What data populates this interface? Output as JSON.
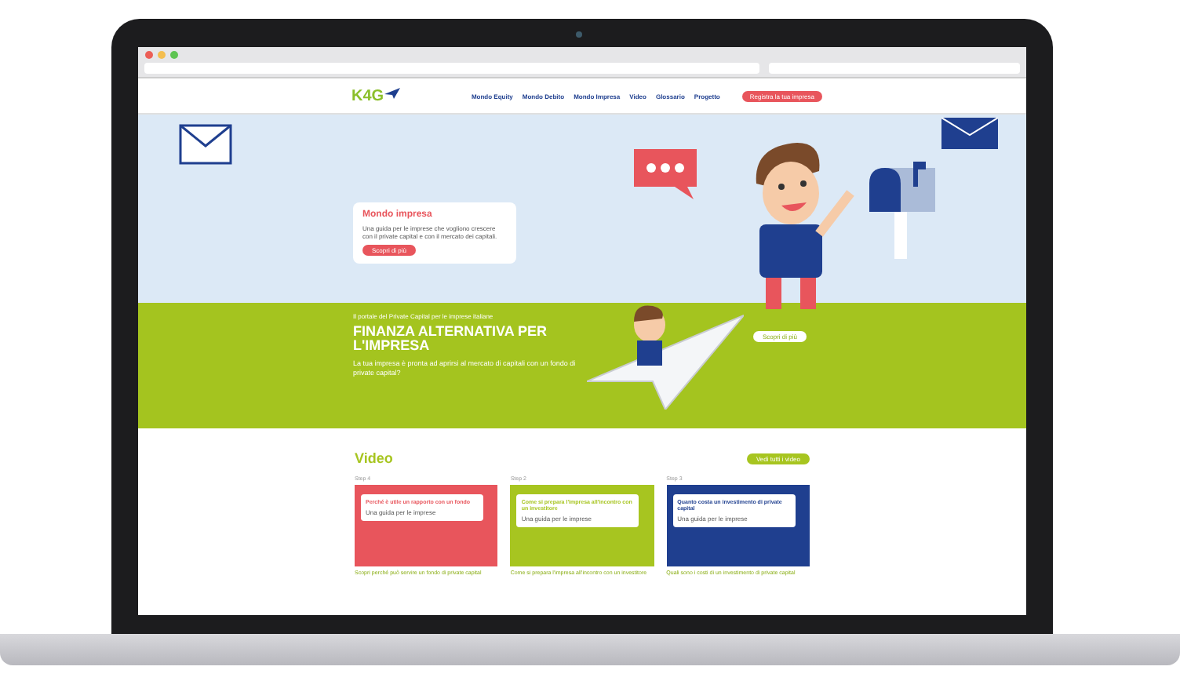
{
  "site": {
    "logo": "K4G",
    "nav": [
      {
        "label": "Mondo Equity"
      },
      {
        "label": "Mondo Debito"
      },
      {
        "label": "Mondo Impresa"
      },
      {
        "label": "Video"
      },
      {
        "label": "Glossario"
      },
      {
        "label": "Progetto"
      }
    ],
    "cta": "Registra la tua impresa"
  },
  "hero_card": {
    "title": "Mondo impresa",
    "text": "Una guida per le imprese che vogliono crescere con il private capital e con il mercato dei capitali.",
    "button": "Scopri di più"
  },
  "banner": {
    "kicker": "Il portale del Private Capital per le imprese italiane",
    "title": "FINANZA ALTERNATIVA PER L'IMPRESA",
    "text": "La tua impresa è pronta ad aprirsi al mercato di capitali con un fondo di private capital?",
    "button": "Scopri di più"
  },
  "videos": {
    "title": "Video",
    "button": "Vedi tutti i video",
    "items": [
      {
        "label": "Step 4",
        "title": "Perché è utile un rapporto con un fondo",
        "subtitle": "Una guida per le imprese",
        "caption": "Scopri perché può servire un fondo di private capital",
        "color": "#e8555c"
      },
      {
        "label": "Step 2",
        "title": "Come si prepara l'impresa all'incontro con un investitore",
        "subtitle": "Una guida per le imprese",
        "caption": "Come si prepara l'impresa all'incontro con un investitore",
        "color": "#a7c520"
      },
      {
        "label": "Step 3",
        "title": "Quanto costa un investimento di private capital",
        "subtitle": "Una guida per le imprese",
        "caption": "Quali sono i costi di un investimento di private capital",
        "color": "#1f3f8f"
      }
    ]
  }
}
